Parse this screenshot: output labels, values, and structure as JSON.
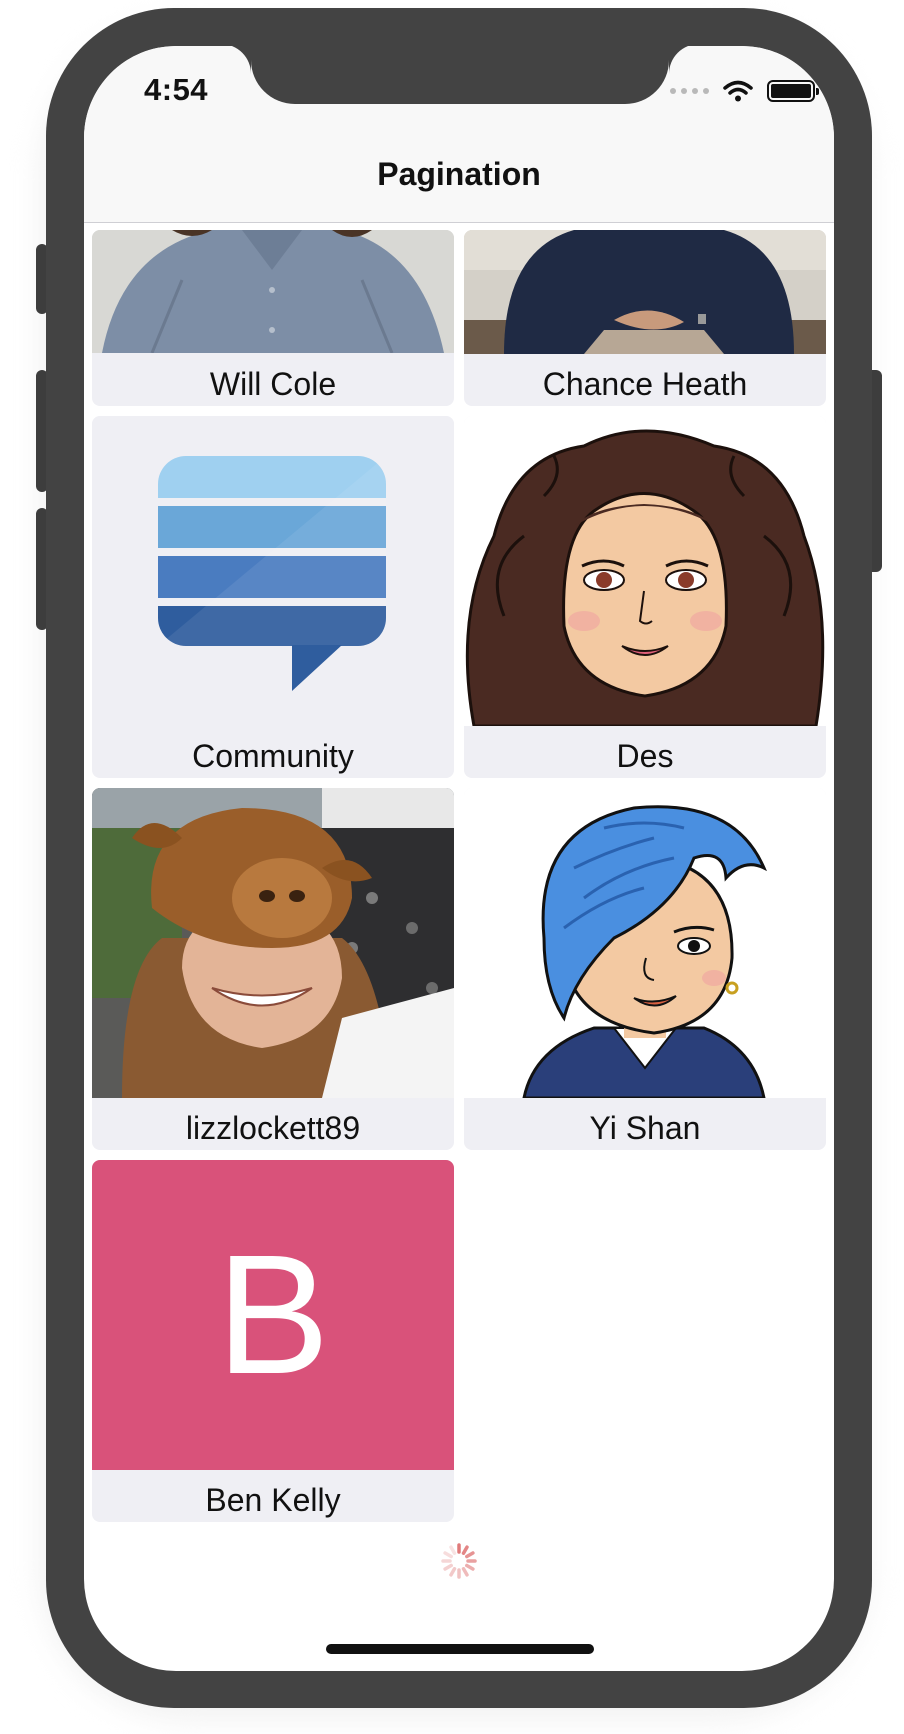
{
  "status_bar": {
    "time": "4:54"
  },
  "nav": {
    "title": "Pagination"
  },
  "users": [
    {
      "name": "Will Cole",
      "avatar": "photo-man-shirt-icon"
    },
    {
      "name": "Chance Heath",
      "avatar": "photo-man-suit-icon"
    },
    {
      "name": "Community",
      "avatar": "stack-exchange-logo-icon"
    },
    {
      "name": "Des",
      "avatar": "bitmoji-curly-hair-icon"
    },
    {
      "name": "lizzlockett89",
      "avatar": "photo-woman-hat-icon"
    },
    {
      "name": "Yi Shan",
      "avatar": "bitmoji-blue-hair-icon"
    },
    {
      "name": "Ben Kelly",
      "avatar": "letter-avatar-icon",
      "initial": "B",
      "color": "#d9527a"
    }
  ],
  "colors": {
    "cell_bg": "#efeff4",
    "frame": "#434343",
    "spinner": "#e07a7a"
  }
}
